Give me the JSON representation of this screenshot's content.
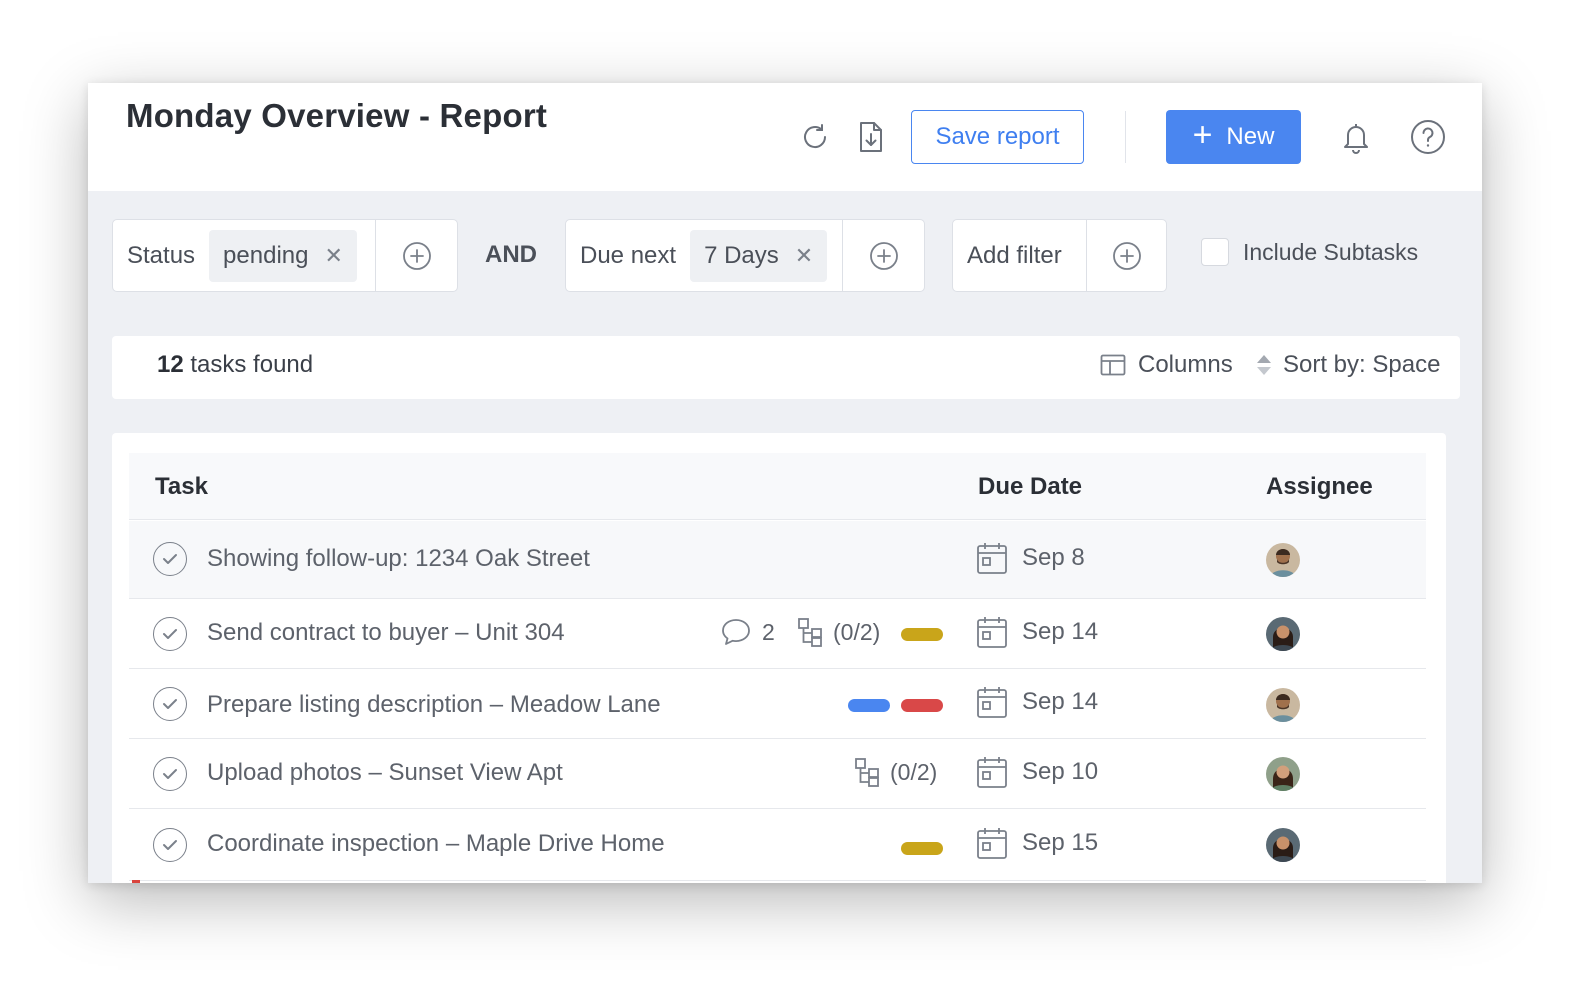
{
  "header": {
    "title": "Monday Overview - Report",
    "refresh_icon": "refresh-icon",
    "export_icon": "file-download-icon",
    "save_label": "Save report",
    "new_label": "New",
    "notification_icon": "bell-icon",
    "help_icon": "help-icon"
  },
  "filters": {
    "group1": {
      "field": "Status",
      "value": "pending"
    },
    "connector": "AND",
    "group2": {
      "field": "Due next",
      "value": "7 Days"
    },
    "add_filter_label": "Add filter",
    "include_subtasks_label": "Include Subtasks",
    "include_subtasks_checked": false
  },
  "summary": {
    "count": "12",
    "found_suffix": " tasks found",
    "columns_label": "Columns",
    "sort_label": "Sort by: Space"
  },
  "table": {
    "headers": {
      "task": "Task",
      "due_date": "Due Date",
      "assignee": "Assignee"
    },
    "rows": [
      {
        "name": "Showing follow-up: 1234 Oak Street",
        "due": "Sep 8"
      },
      {
        "name": "Send contract to buyer – Unit 304",
        "comments": "2",
        "subtasks": "(0/2)",
        "due": "Sep 14"
      },
      {
        "name": "Prepare listing description – Meadow Lane",
        "due": "Sep 14"
      },
      {
        "name": "Upload photos – Sunset View Apt",
        "subtasks": "(0/2)",
        "due": "Sep 10"
      },
      {
        "name": "Coordinate inspection – Maple Drive Home",
        "due": "Sep 15"
      }
    ]
  },
  "colors": {
    "accent": "#4a86f0",
    "tag_yellow": "#c9a51a",
    "tag_blue": "#4a86f0",
    "tag_red": "#d94848"
  }
}
